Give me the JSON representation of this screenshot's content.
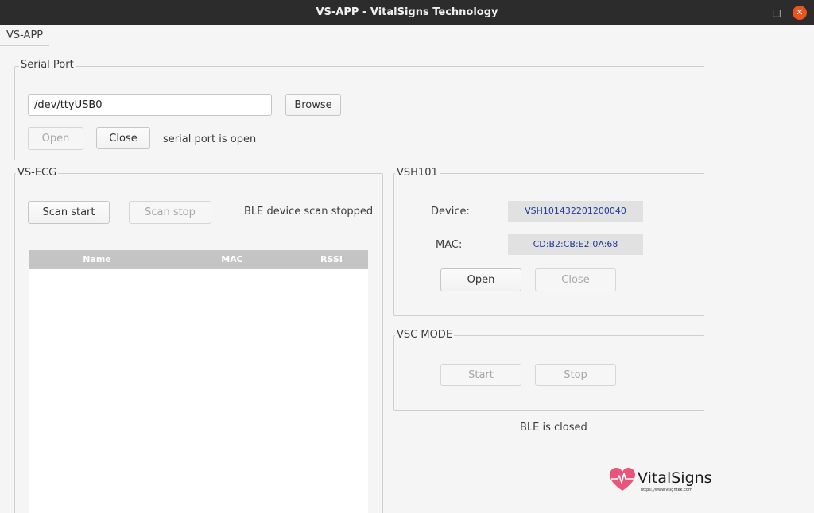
{
  "window": {
    "title": "VS-APP - VitalSigns Technology",
    "minimize_glyph": "–",
    "maximize_glyph": "□",
    "close_glyph": "✕"
  },
  "menu": {
    "items": [
      "VS-APP"
    ]
  },
  "serial_port": {
    "title": "Serial Port",
    "path_value": "/dev/ttyUSB0",
    "browse_label": "Browse",
    "open_label": "Open",
    "close_label": "Close",
    "status": "serial port is open"
  },
  "vs_ecg": {
    "title": "VS-ECG",
    "scan_start_label": "Scan start",
    "scan_stop_label": "Scan stop",
    "status": "BLE device scan stopped",
    "columns": [
      "Name",
      "MAC",
      "RSSI"
    ],
    "rows": []
  },
  "vsh101": {
    "title": "VSH101",
    "device_label": "Device:",
    "device_value": "VSH101432201200040",
    "mac_label": "MAC:",
    "mac_value": "CD:B2:CB:E2:0A:68",
    "open_label": "Open",
    "close_label": "Close"
  },
  "vsc_mode": {
    "title": "VSC MODE",
    "start_label": "Start",
    "stop_label": "Stop"
  },
  "ble_status": "BLE is closed",
  "logo": {
    "name": "VitalSigns",
    "url": "https://www.vsigntek.com",
    "heart_color": "#e8547a"
  }
}
